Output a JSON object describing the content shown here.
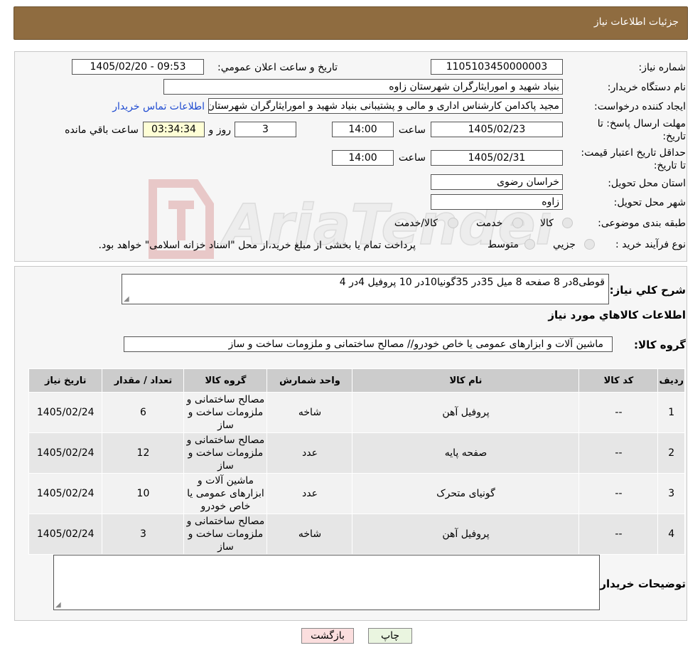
{
  "header": {
    "title": "جزئیات اطلاعات نیاز"
  },
  "form": {
    "need_number": {
      "label": "شماره نیاز:",
      "value": "1105103450000003"
    },
    "announce_datetime": {
      "label": "تاریخ و ساعت اعلان عمومي:",
      "value": "1405/02/20 - 09:53"
    },
    "buyer_org": {
      "label": "نام دستگاه خريدار:",
      "value": "بنیاد شهید و امورایثارگران شهرستان زاوه"
    },
    "requester": {
      "label": "ايجاد كننده درخواست:",
      "value": "مجید پاکدامن کارشناس اداری و مالی و پشتیبانی بنیاد شهید و امورایثارگران شهرستان زاوه",
      "contact_link": "اطلاعات تماس خریدار"
    },
    "deadline": {
      "label": "مهلت ارسال پاسخ: تا تاریخ:",
      "date": "1405/02/23",
      "time_label": "ساعت",
      "time": "14:00",
      "days": "3",
      "days_label": "روز و",
      "remaining": "03:34:34",
      "remaining_label": "ساعت باقي مانده"
    },
    "price_validity": {
      "label": "حداقل تاريخ اعتبار قيمت: تا تاریخ:",
      "date": "1405/02/31",
      "time_label": "ساعت",
      "time": "14:00"
    },
    "delivery_province": {
      "label": "استان محل تحويل:",
      "value": "خراسان رضوی"
    },
    "delivery_city": {
      "label": "شهر محل تحويل:",
      "value": "زاوه"
    },
    "category": {
      "label": "طبقه بندی موضوعی:",
      "options": [
        "کالا",
        "خدمت",
        "کالا/خدمت"
      ]
    },
    "process_type": {
      "label": "نوع فرآيند خريد :",
      "options": [
        "جزیي",
        "متوسط"
      ],
      "note": "پرداخت تمام یا بخشی از مبلغ خرید،از محل \"اسناد خزانه اسلامی\" خواهد بود."
    }
  },
  "description": {
    "label": "شرح كلي نياز:",
    "value": "قوطی8در 8 صفحه 8 میل 35در 35گونیا10در 10 پروفیل 4در 4"
  },
  "goods_section": {
    "title": "اطلاعات كالاهاي مورد نياز",
    "group_label": "گروه كالا:",
    "group_value": "ماشین آلات و ابزارهای عمومی یا خاص خودرو// مصالح ساختمانی و ملزومات ساخت و ساز"
  },
  "table": {
    "headers": [
      "رديف",
      "كد كالا",
      "نام كالا",
      "واحد شمارش",
      "گروه كالا",
      "تعداد / مقدار",
      "تاريخ نياز"
    ],
    "rows": [
      [
        "1",
        "--",
        "پروفیل آهن",
        "شاخه",
        "مصالح ساختمانی و ملزومات ساخت و ساز",
        "6",
        "1405/02/24"
      ],
      [
        "2",
        "--",
        "صفحه پایه",
        "عدد",
        "مصالح ساختمانی و ملزومات ساخت و ساز",
        "12",
        "1405/02/24"
      ],
      [
        "3",
        "--",
        "گونیای متحرک",
        "عدد",
        "ماشین آلات و ابزارهای عمومی یا خاص خودرو",
        "10",
        "1405/02/24"
      ],
      [
        "4",
        "--",
        "پروفیل آهن",
        "شاخه",
        "مصالح ساختمانی و ملزومات ساخت و ساز",
        "3",
        "1405/02/24"
      ]
    ]
  },
  "buyer_notes": {
    "label": "توضيحات خريدار:",
    "value": ""
  },
  "buttons": {
    "print": "چاپ",
    "back": "بازگشت"
  },
  "watermark_text": "AriaTender.neT",
  "colors": {
    "header_bg": "#8f6c40",
    "print_btn": "#eaf5e0",
    "back_btn": "#fbdede",
    "remaining_bg": "#fefed5"
  }
}
